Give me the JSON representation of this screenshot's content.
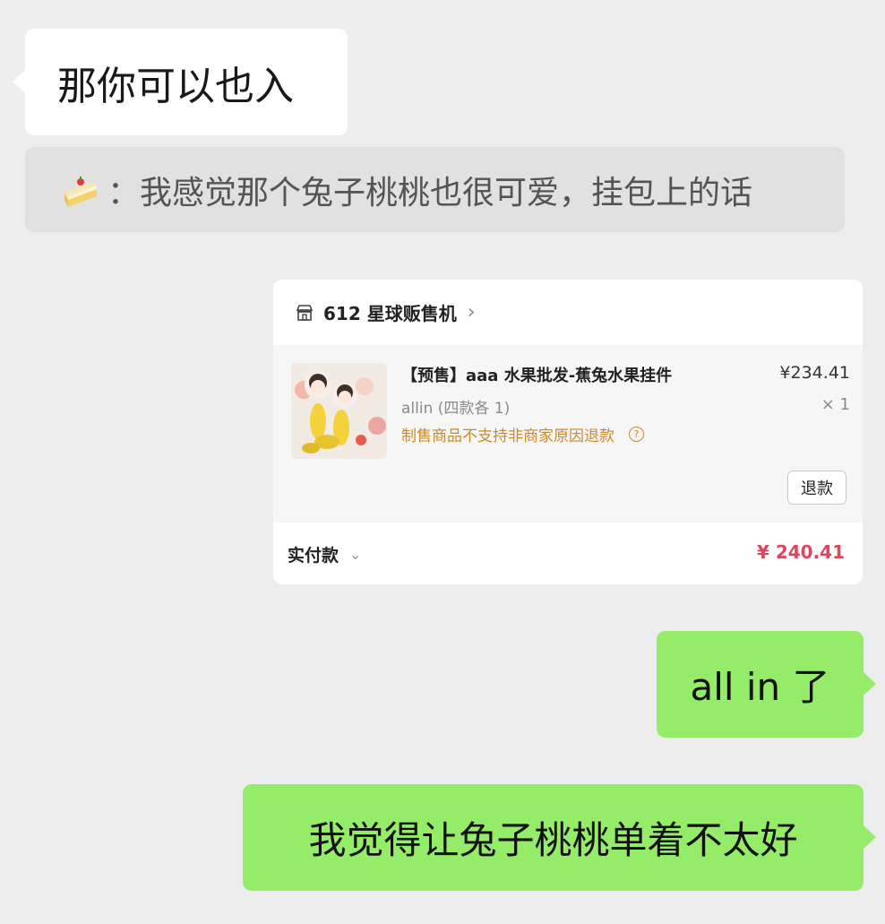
{
  "messages": {
    "left_message": "那你可以也入",
    "quote_text": "：我感觉那个兔子桃桃也很可爱，挂包上的话",
    "quote_icon": "cake-emoji-icon",
    "reply1": "all in 了",
    "reply2": "我觉得让兔子桃桃单着不太好"
  },
  "order_card": {
    "shop_name": "612 星球贩售机",
    "shop_icon": "shop-icon",
    "product_title": "【预售】aaa 水果批发-蕉兔水果挂件",
    "price": "¥234.41",
    "variant": "allin (四款各 1)",
    "quantity": "× 1",
    "notice": "制售商品不支持非商家原因退款",
    "refund_button": "退款",
    "paid_label": "实付款",
    "paid_total": "¥ 240.41"
  },
  "colors": {
    "background": "#ededed",
    "bubble_self": "#95ec69",
    "bubble_other": "#ffffff",
    "quote_bg": "#e1e1e1",
    "notice_color": "#c98a2c",
    "total_color": "#e0455b"
  }
}
